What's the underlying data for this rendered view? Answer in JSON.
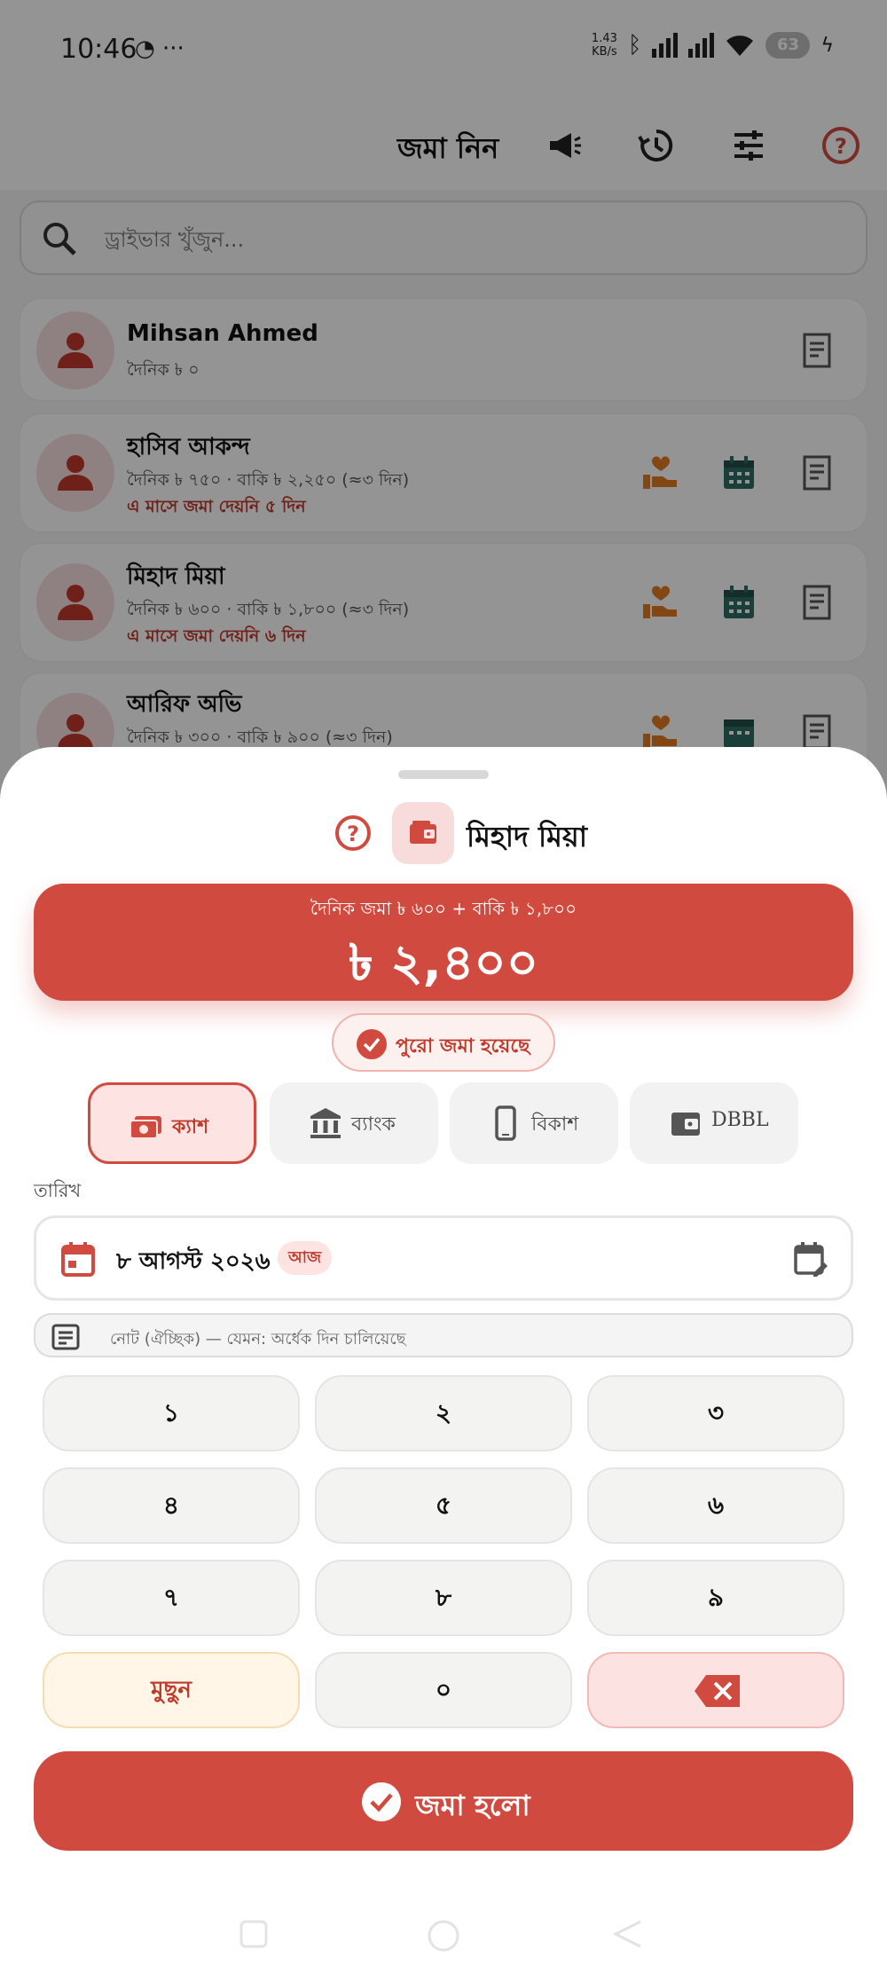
{
  "status": {
    "time": "10:46",
    "net_speed": "1.43\nKB/s",
    "battery": "63"
  },
  "topbar": {
    "title": "জমা নিন"
  },
  "search": {
    "placeholder": "ড্রাইভার খুঁজুন..."
  },
  "drivers": [
    {
      "name": "Mihsan Ahmed",
      "line": "দৈনিক ৳ ০",
      "warning": ""
    },
    {
      "name": "হাসিব আকন্দ",
      "line": "দৈনিক ৳ ৭৫০ · বাকি ৳ ২,২৫০ (≈৩ দিন)",
      "warning": "এ মাসে জমা দেয়নি ৫ দিন"
    },
    {
      "name": "মিহাদ মিয়া",
      "line": "দৈনিক ৳ ৬০০ · বাকি ৳ ১,৮০০ (≈৩ দিন)",
      "warning": "এ মাসে জমা দেয়নি ৬ দিন"
    },
    {
      "name": "আরিফ অভি",
      "line": "দৈনিক ৳ ৩০০ · বাকি ৳ ৯০০ (≈৩ দিন)",
      "warning": ""
    }
  ],
  "sheet": {
    "driver_name": "মিহাদ মিয়া",
    "amount_breakdown": "দৈনিক জমা ৳ ৬০০  +  বাকি ৳ ১,৮০০",
    "amount_total": "৳ ২,৪০০",
    "full_paid_label": "পুরো জমা হয়েছে",
    "methods": [
      {
        "label": "ক্যাশ",
        "icon": "cash-icon",
        "active": true
      },
      {
        "label": "ব্যাংক",
        "icon": "bank-icon",
        "active": false
      },
      {
        "label": "বিকাশ",
        "icon": "phone-icon",
        "active": false
      },
      {
        "label": "DBBL",
        "icon": "wallet-icon",
        "active": false
      }
    ],
    "date_label": "তারিখ",
    "date_value": "৮ আগস্ট ২০২৬",
    "today_badge": "আজ",
    "note_placeholder": "নোট (ঐচ্ছিক) — যেমন: অর্ধেক দিন চালিয়েছে",
    "keys": [
      "১",
      "২",
      "৩",
      "৪",
      "৫",
      "৬",
      "৭",
      "৮",
      "৯",
      "মুছুন",
      "০"
    ],
    "submit_label": "জমা হলো"
  },
  "colors": {
    "accent": "#d14a3f",
    "accent_light": "#fde3e1",
    "teal": "#2e6b62",
    "orange": "#e07b22"
  }
}
